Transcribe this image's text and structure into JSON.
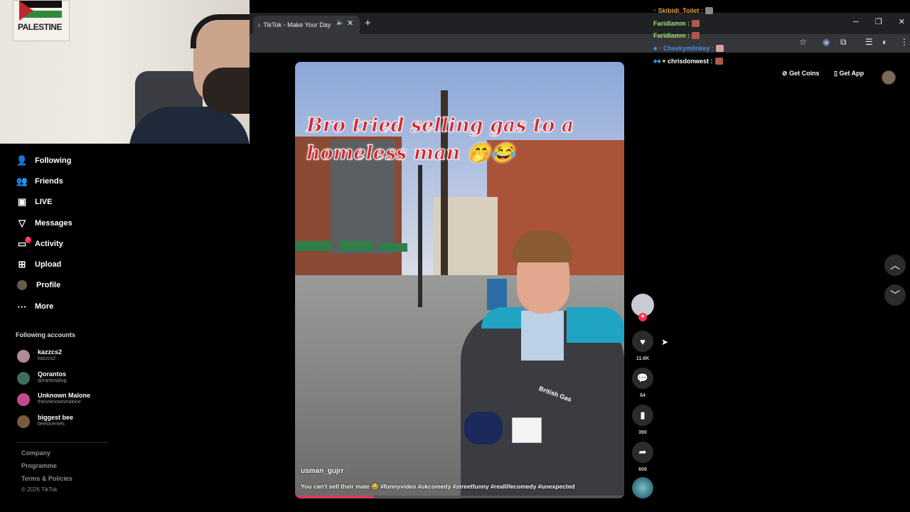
{
  "browser": {
    "tab_title": "TikTok - Make Your Day",
    "new_tab": "+",
    "close_tab": "✕"
  },
  "webcam": {
    "poster_text": "PALESTINE"
  },
  "sidebar": {
    "nav": [
      {
        "label": "Following"
      },
      {
        "label": "Friends"
      },
      {
        "label": "LIVE"
      },
      {
        "label": "Messages"
      },
      {
        "label": "Activity"
      },
      {
        "label": "Upload"
      },
      {
        "label": "Profile"
      },
      {
        "label": "More"
      }
    ],
    "activity_badge": "7",
    "following_title": "Following accounts",
    "accounts": [
      {
        "name": "kazzcs2",
        "handle": "kazzcs2",
        "color": "#b08a9a"
      },
      {
        "name": "Qorantos",
        "handle": "qorantosplug",
        "color": "#3c6e5a"
      },
      {
        "name": "Unknown Malone",
        "handle": "theunknownmalone",
        "color": "#c24a8a"
      },
      {
        "name": "biggest bee",
        "handle": "beelovemes",
        "color": "#7a5a3c"
      }
    ],
    "footer": [
      "Company",
      "Programme",
      "Terms & Policies"
    ],
    "copyright": "© 2026 TikTok"
  },
  "chat": [
    {
      "user": "Skibidi_Toilet :",
      "color": "#e8a33a"
    },
    {
      "user": "Faridlamm :",
      "color": "#9be36b"
    },
    {
      "user": "Faridlamm :",
      "color": "#9be36b"
    },
    {
      "user": "Cheekym0nkey :",
      "color": "#4a8fd8"
    },
    {
      "user": "chrisdonwest :",
      "color": "#ffffff"
    }
  ],
  "header": {
    "get_coins": "Get Coins",
    "get_app": "Get App"
  },
  "video": {
    "caption": "Bro tried selling gas to a homeless man 🤭😂",
    "jacket_logo": "British Gas",
    "author": "usman_gujrr",
    "description": "You can't sell their mate 😂 #funnyvideo #ukcomedy #streetfunny #reallifecomedy #unexpected",
    "progress": 0.24
  },
  "actions": {
    "likes": "11.6K",
    "comments": "64",
    "saves": "390",
    "shares": "606"
  }
}
